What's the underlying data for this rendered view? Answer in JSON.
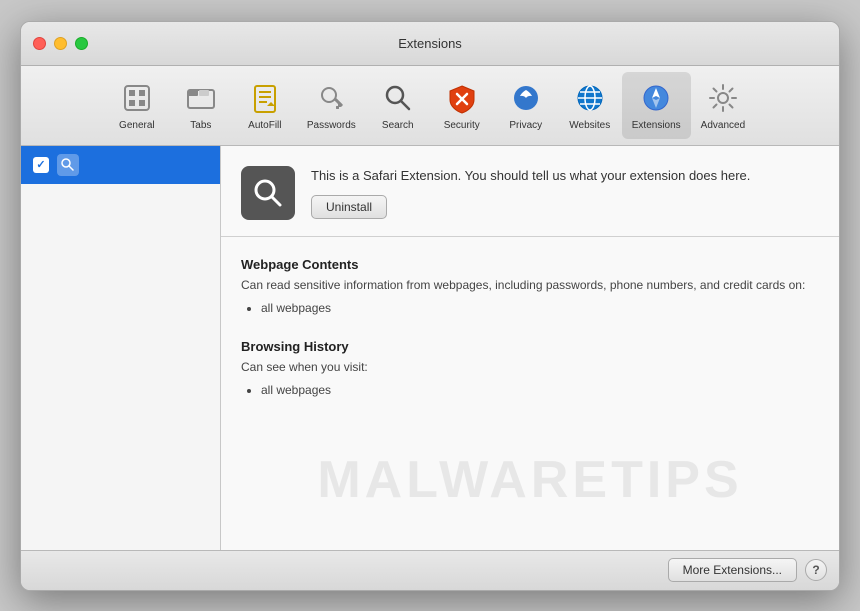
{
  "window": {
    "title": "Extensions"
  },
  "titlebar": {
    "title": "Extensions",
    "controls": {
      "close": "close",
      "minimize": "minimize",
      "maximize": "maximize"
    }
  },
  "toolbar": {
    "items": [
      {
        "id": "general",
        "label": "General",
        "icon": "general"
      },
      {
        "id": "tabs",
        "label": "Tabs",
        "icon": "tabs"
      },
      {
        "id": "autofill",
        "label": "AutoFill",
        "icon": "autofill"
      },
      {
        "id": "passwords",
        "label": "Passwords",
        "icon": "passwords"
      },
      {
        "id": "search",
        "label": "Search",
        "icon": "search"
      },
      {
        "id": "security",
        "label": "Security",
        "icon": "security"
      },
      {
        "id": "privacy",
        "label": "Privacy",
        "icon": "privacy"
      },
      {
        "id": "websites",
        "label": "Websites",
        "icon": "websites"
      },
      {
        "id": "extensions",
        "label": "Extensions",
        "icon": "extensions",
        "active": true
      },
      {
        "id": "advanced",
        "label": "Advanced",
        "icon": "advanced"
      }
    ]
  },
  "sidebar": {
    "items": [
      {
        "id": "search-ext",
        "label": "",
        "checked": true,
        "selected": true
      }
    ]
  },
  "extension": {
    "description": "This is a Safari Extension. You should tell us what your extension does here.",
    "uninstall_label": "Uninstall",
    "permissions": [
      {
        "title": "Webpage Contents",
        "description": "Can read sensitive information from webpages, including passwords, phone numbers, and credit cards on:",
        "items": [
          "all webpages"
        ]
      },
      {
        "title": "Browsing History",
        "description": "Can see when you visit:",
        "items": [
          "all webpages"
        ]
      }
    ]
  },
  "bottom_bar": {
    "more_extensions_label": "More Extensions...",
    "help_label": "?"
  },
  "watermark": {
    "text": "MALWARETIPS"
  }
}
